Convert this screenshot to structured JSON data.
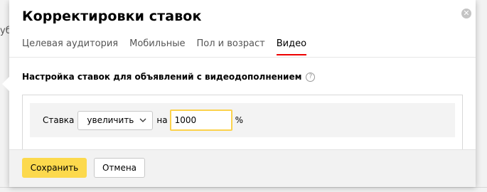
{
  "background": {
    "fragment_text": "уб"
  },
  "dialog": {
    "title": "Корректировки ставок",
    "close_icon": "close-icon"
  },
  "tabs": [
    {
      "label": "Целевая аудитория",
      "active": false
    },
    {
      "label": "Мобильные",
      "active": false
    },
    {
      "label": "Пол и возраст",
      "active": false
    },
    {
      "label": "Видео",
      "active": true
    }
  ],
  "section": {
    "title": "Настройка ставок для объявлений с видеодополнением",
    "help_icon": "help-icon",
    "help_glyph": "?"
  },
  "rate_row": {
    "label": "Ставка",
    "mode_selected": "увеличить",
    "na_label": "на",
    "value": "1000",
    "unit": "%"
  },
  "footer": {
    "save_label": "Сохранить",
    "cancel_label": "Отмена"
  },
  "colors": {
    "accent_yellow": "#fcd94d",
    "active_tab_underline": "#ee0000",
    "input_focus_border": "#fbd24d"
  }
}
